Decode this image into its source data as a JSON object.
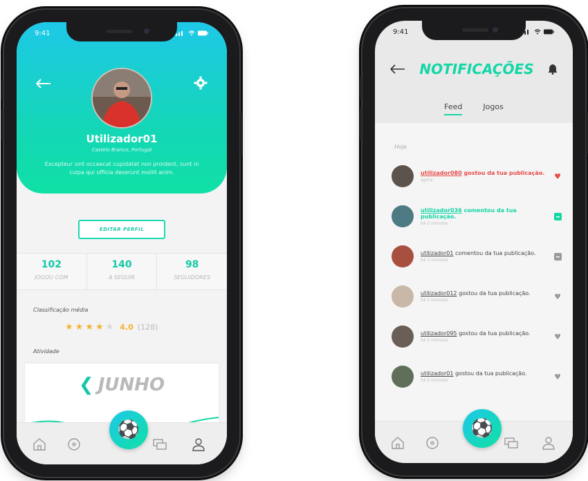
{
  "left_phone": {
    "status_time": "9:41",
    "profile": {
      "username": "Utilizador01",
      "location": "Castelo Branco, Portugal",
      "bio": "Excepteur sint occaecat cupidatat non proident, sunt in culpa qui officia deserunt mollit anim.",
      "edit_button": "EDITAR PERFIL"
    },
    "stats": [
      {
        "value": "102",
        "label": "JOGOU COM"
      },
      {
        "value": "140",
        "label": "A SEGUIR"
      },
      {
        "value": "98",
        "label": "SEGUIDORES"
      }
    ],
    "rating_label": "Classificação média",
    "rating_value": "4.0",
    "rating_count": "(128)",
    "rating_stars": 4,
    "activity_label": "Atividade",
    "activity_month": "JUNHO"
  },
  "right_phone": {
    "status_time": "9:41",
    "title": "NOTIFICAÇÕES",
    "tabs": [
      "Feed",
      "Jogos"
    ],
    "active_tab": "Feed",
    "section_label": "Hoje",
    "notifications": [
      {
        "user": "utilizador080",
        "action": "gostou da tua publicação.",
        "time": "agora",
        "icon": "heart-icon",
        "highlight": "red"
      },
      {
        "user": "utilizador036",
        "action": "comentou da tua publicação.",
        "time": "há 2 minutos",
        "icon": "comment-icon",
        "highlight": "green"
      },
      {
        "user": "utilizador01",
        "action": "comentou da tua publicação.",
        "time": "há 3 minutos",
        "icon": "comment-icon",
        "highlight": "none"
      },
      {
        "user": "utilizador012",
        "action": "gostou da tua publicação.",
        "time": "há 5 minutos",
        "icon": "heart-icon",
        "highlight": "none"
      },
      {
        "user": "utilizador095",
        "action": "gostou da tua publicação.",
        "time": "há 5 minutos",
        "icon": "heart-icon",
        "highlight": "none"
      },
      {
        "user": "utilizador01",
        "action": "gostou da tua publicação.",
        "time": "há 5 minutos",
        "icon": "heart-icon",
        "highlight": "none"
      }
    ]
  },
  "colors": {
    "accent_green": "#14d6a6",
    "accent_cyan": "#1ec8e8",
    "like_red": "#e84a4a",
    "star": "#f5b233"
  }
}
